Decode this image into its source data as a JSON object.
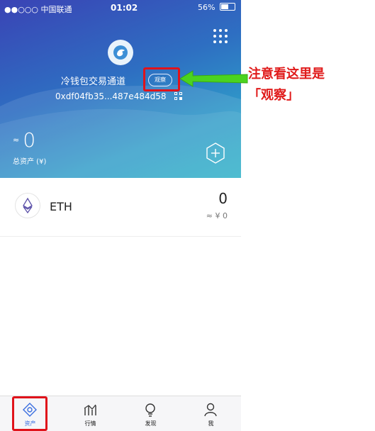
{
  "status_bar": {
    "carrier": "●●○○○ 中国联通",
    "time": "01:02",
    "battery": "56%"
  },
  "wallet": {
    "name": "冷钱包交易通道",
    "watch_badge": "观察",
    "address": "0xdf04fb35...487e484d58",
    "balance_approx": "≈",
    "balance": "0",
    "total_label": "总资产 (¥)"
  },
  "tokens": [
    {
      "symbol": "ETH",
      "amount": "0",
      "value": "≈ ¥ 0"
    }
  ],
  "tabbar": {
    "tabs": [
      {
        "label": "资产",
        "icon": "assets-icon",
        "active": true
      },
      {
        "label": "行情",
        "icon": "market-icon",
        "active": false
      },
      {
        "label": "发现",
        "icon": "discover-icon",
        "active": false
      },
      {
        "label": "我",
        "icon": "profile-icon",
        "active": false
      }
    ]
  },
  "annotation": {
    "line1": "注意看这里是",
    "line2": "「观察」"
  },
  "colors": {
    "hero_start": "#3a43b5",
    "hero_end": "#2ab0c8",
    "highlight": "#e0131b",
    "arrow": "#4bd31f",
    "active_tab": "#3b6fe0"
  }
}
